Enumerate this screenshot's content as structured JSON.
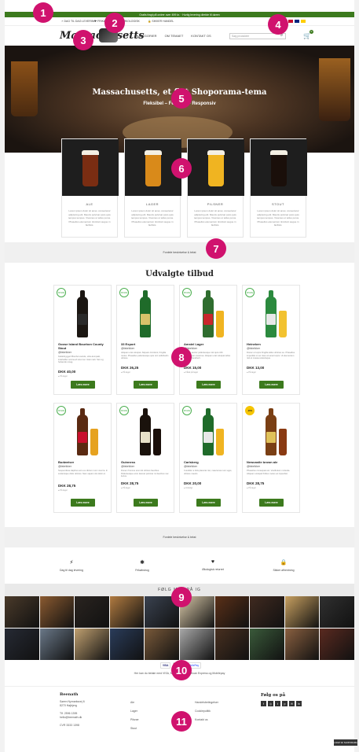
{
  "promo_bar": {
    "text": "Gratis fragt på ordrer over 499 kr. · Hurtig levering direkte til døren"
  },
  "info_bar": {
    "items": [
      {
        "icon": "bolt-icon",
        "glyph": "⚡",
        "label": "DAG TIL DAG LEVERING"
      },
      {
        "icon": "heart-icon",
        "glyph": "❤",
        "label": "FRIKØBSBOK"
      },
      {
        "icon": "tag-icon",
        "glyph": "♥",
        "label": "ØKOLOGISK"
      },
      {
        "icon": "lock-icon",
        "glyph": "🔒",
        "label": "SIKKER HANDEL"
      }
    ],
    "flag_colors": [
      "#c8102e",
      "#00247d",
      "#ffce00"
    ]
  },
  "header": {
    "logo": "Massachusetts",
    "nav": [
      "KATEGORIER",
      "OM TEMAET",
      "KONTAKT OS"
    ],
    "search_placeholder": "Søg produkter",
    "cart_count": "0"
  },
  "hero": {
    "title": "Massachusetts, et flot Shoporama-tema",
    "subtitle": "Fleksibel – Feminin – Responsiv"
  },
  "categories": [
    {
      "name": "ALE",
      "beer_color": "#7a2d12",
      "text": "Lorem ipsum dolor sit amet, consectetur adipiscing elit. Mauris pulvinar justo quis tempus tempus. Vivamus ut tellus purus. Phasellus elementum tincidunt augue in facilisis."
    },
    {
      "name": "LAGER",
      "beer_color": "#d98a1a",
      "text": "Lorem ipsum dolor sit amet, consectetur adipiscing elit. Mauris pulvinar justo quis tempus tempus. Vivamus ut tellus purus. Phasellus elementum tincidunt augue in facilisis."
    },
    {
      "name": "PILSNER",
      "beer_color": "#f0b421",
      "text": "Lorem ipsum dolor sit amet, consectetur adipiscing elit. Mauris pulvinar justo quis tempus tempus. Vivamus ut tellus purus. Phasellus elementum tincidunt augue in facilisis."
    },
    {
      "name": "STOUT",
      "beer_color": "#1a0f0a",
      "text": "Lorem ipsum dolor sit amet, consectetur adipiscing elit. Mauris pulvinar justo quis tempus tempus. Vivamus ut tellus purus. Phasellus elementum tincidunt augue in facilisis."
    }
  ],
  "strip1": {
    "text": "Fordele beskrivelse & tekst"
  },
  "offers_title": "Udvalgte tilbud",
  "products": [
    {
      "tag": "SPARE",
      "sale": false,
      "name": "Goose Island Bourbon County Stout",
      "brand": "@fabrikker",
      "desc": "Kaldebryggeri Bourbon-tønde, ultra-kompakt, indeholder aroma af stout ren ristet malt. Stor og helsende smag.",
      "price": "DKK 40,00",
      "stock": "● På lager",
      "button": "Læs mere",
      "bottle": "#1b1612",
      "label": "#2a2a2a",
      "glass": ""
    },
    {
      "tag": "SPARE",
      "sale": false,
      "name": "33 Export",
      "brand": "@fabrikker",
      "desc": "Aliquam erat volutpat. Aliquam tincidunt, fringilla metus. Phasellus pellentesque quis orci sollicitudin ultrices.",
      "price": "DKK 26,25",
      "stock": "● På lager",
      "button": "Læs mere",
      "bottle": "#1f6b2a",
      "label": "#d8c26a",
      "glass": ""
    },
    {
      "tag": "SPARE",
      "sale": false,
      "name": "Amstel Lager",
      "brand": "@fabrikker",
      "desc": "Aenean auctor pellentesque nisl quis nibh ullamcorper maximus. Aliquam erat volutpat tellus pulvinar hendrerit.",
      "price": "DKK 15,00",
      "stock": "● Fåtal på lager",
      "button": "Læs mere",
      "bottle": "#2f6d2f",
      "label": "#c9272c",
      "glass": "#f0b421"
    },
    {
      "tag": "SPARE",
      "sale": false,
      "name": "Heineken",
      "brand": "@fabrikker",
      "desc": "Donec ut turpis fringilla tellus ultricies eu. Phasellus imperdiet mi ac risus sit amet turpis. Ut elementum nisl et massa scelerisque.",
      "price": "DKK 13,00",
      "stock": "● På lager",
      "button": "Læs mere",
      "bottle": "#2b8a3e",
      "label": "#e8e8e8",
      "glass": "#f2c230"
    },
    {
      "tag": "SPARE",
      "sale": false,
      "name": "Budweiser",
      "brand": "@fabrikker",
      "desc": "Suspendisse dapibus arcu eu dictum nunc viverra. In scelerisque dolor ultrices. Nam sapien nisi dolor et.",
      "price": "DKK 28,75",
      "stock": "● På lager",
      "button": "Læs mere",
      "bottle": "#5a2a12",
      "label": "#c8102e",
      "glass": "#e6a220"
    },
    {
      "tag": "SPARE",
      "sale": false,
      "name": "Guinness",
      "brand": "@fabrikker",
      "desc": "Donec rhoncus erat nisl ultrices faucibus. Pellentesque enim laoreet pulvinar mi faucibus nec luctus.",
      "price": "DKK 28,75",
      "stock": "● På lager",
      "button": "Læs mere",
      "bottle": "#1a120c",
      "label": "#e8e1c8",
      "glass": "#1a0f0a"
    },
    {
      "tag": "SPARE",
      "sale": false,
      "name": "Carlsberg",
      "brand": "@fabrikker",
      "desc": "Curabitur a felis placerat nisi, maecenas nunc eget, ultrices mauris.",
      "price": "DKK 20,00",
      "stock": "● Udsolgt",
      "button": "Læs mere",
      "bottle": "#1f6b2a",
      "label": "#e8e8e8",
      "glass": "#f0b421"
    },
    {
      "tag": "-20%",
      "sale": true,
      "name": "Newcastle brown ale",
      "brand": "@fabrikker",
      "desc": "Phasellus consequat est. Vestibulum molestie. Aliquam volutpat finibus metus ac imperdiet.",
      "price": "DKK 28,75",
      "stock": "● På lager",
      "button": "Læs mere",
      "bottle": "#7a3f14",
      "label": "#e0c25a",
      "glass": "#8a3a12"
    }
  ],
  "strip2": {
    "text": "Fordele beskrivelse & tekst"
  },
  "usps": [
    {
      "icon": "bolt-icon",
      "glyph": "⚡",
      "label": "Dag til dag levering"
    },
    {
      "icon": "gift-icon",
      "glyph": "✱",
      "label": "Frikøbsbog"
    },
    {
      "icon": "heart-icon",
      "glyph": "♥",
      "label": "Økologisk returret"
    },
    {
      "icon": "lock-icon",
      "glyph": "🔒",
      "label": "Sikker afhentning"
    }
  ],
  "instagram": {
    "heading": "FØLG MED PÅ IG",
    "tiles": [
      "#4a3a2a",
      "#8a5a30",
      "#2a2420",
      "#b07a40",
      "#3a4250",
      "#d8c8a8",
      "#5a3018",
      "#402a20",
      "#c8a060",
      "#303030",
      "#262a34",
      "#6a7888",
      "#c0a070",
      "#2a3c5a",
      "#7a5a3a",
      "#a8a8a8",
      "#483020",
      "#3a5a3a",
      "#8a6040",
      "#5a2a20"
    ]
  },
  "payment": {
    "cards": [
      {
        "label": "VISA",
        "bg": "#ffffff",
        "color": "#1a1f71"
      },
      {
        "label": "MC",
        "bg": "#eb001b",
        "color": "#ffffff"
      },
      {
        "label": "MobilePay",
        "bg": "#ffffff",
        "color": "#5a78ff"
      }
    ],
    "text": "Her kan du betale med VISA, Mastercard, American Express og Mobilepay"
  },
  "footer": {
    "shop_name": "Beenath",
    "address1": "Søren Nymarksvej 6",
    "address2": "8270 Højbjerg",
    "phone": "Tlf. 2596 1395",
    "email": "hello@beenath.dk",
    "cvr": "CVR 3333 1398",
    "links_col1": [
      "Ale",
      "Lager",
      "Pilsner",
      "Stout"
    ],
    "links_col2": [
      "Handelsbetingelser",
      "Cookiepolitik",
      "Kontakt os"
    ],
    "follow_title": "Følg os på",
    "social": [
      "f",
      "◎",
      "t",
      "p",
      "✉",
      "in"
    ]
  },
  "credit": "LAVET AF SHOPORAMA",
  "badges": [
    "1",
    "2",
    "3",
    "4",
    "5",
    "6",
    "7",
    "8",
    "9",
    "10",
    "11"
  ]
}
